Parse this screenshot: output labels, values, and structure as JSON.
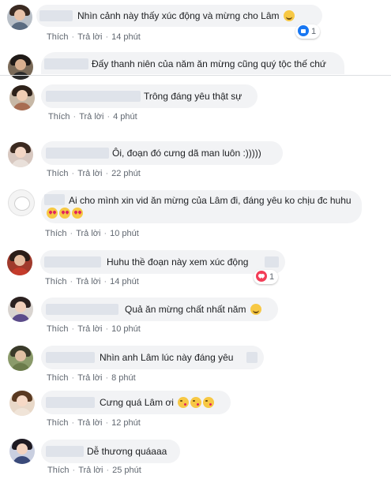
{
  "action_labels": {
    "like": "Thích",
    "reply": "Trả lời",
    "separator": "·"
  },
  "comments": [
    {
      "text": "Nhìn cảnh này thấy xúc động và mừng cho Lâm",
      "emoji": [
        "smile"
      ],
      "time": "14 phút",
      "reaction": {
        "type": "like",
        "count": "1"
      }
    },
    {
      "text": "Đấy thanh niên của năm ăn mừng cũng quý tộc thế chứ",
      "emoji": [],
      "time": "",
      "reaction": null
    },
    {
      "text": "Trông đáng yêu thật sự",
      "emoji": [],
      "time": "4 phút",
      "reaction": null
    },
    {
      "text": "Ôi, đoạn đó cưng dã man luôn :)))))",
      "emoji": [],
      "time": "22 phút",
      "reaction": null
    },
    {
      "text": "Ai cho mình xin vid ăn mừng của Lâm đi, đáng yêu ko chịu đc huhu",
      "emoji": [
        "love",
        "love",
        "love"
      ],
      "time": "10 phút",
      "reaction": null
    },
    {
      "text": "Huhu thề đoạn này xem xúc động",
      "emoji": [],
      "time": "14 phút",
      "reaction": {
        "type": "love",
        "count": "1"
      }
    },
    {
      "text": "Quả ăn mừng chất nhất năm",
      "emoji": [
        "smile"
      ],
      "time": "10 phút",
      "reaction": null
    },
    {
      "text": "Nhìn anh Lâm lúc này đáng yêu",
      "emoji": [],
      "time": "8 phút",
      "reaction": null
    },
    {
      "text": "Cưng quá Lâm ơi",
      "emoji": [
        "kiss",
        "kiss",
        "kiss"
      ],
      "time": "12 phút",
      "reaction": null
    },
    {
      "text": "Dễ thương quáaaa",
      "emoji": [],
      "time": "25 phút",
      "reaction": null
    }
  ]
}
